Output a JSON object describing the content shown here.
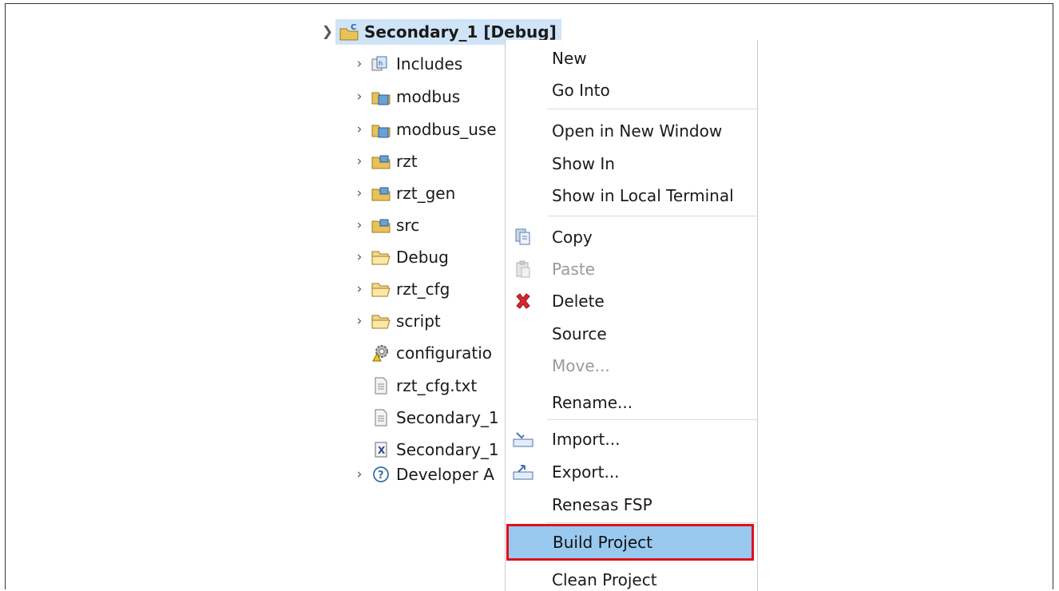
{
  "tree": {
    "root": {
      "label": "Secondary_1 [Debug]",
      "icon": "c-project-icon"
    },
    "items": [
      {
        "label": "Includes",
        "icon": "includes-icon",
        "expandable": true
      },
      {
        "label": "modbus",
        "icon": "source-folder-icon",
        "expandable": true
      },
      {
        "label": "modbus_use",
        "icon": "source-folder-icon",
        "expandable": true
      },
      {
        "label": "rzt",
        "icon": "source-folder-icon",
        "expandable": true
      },
      {
        "label": "rzt_gen",
        "icon": "source-folder-icon",
        "expandable": true
      },
      {
        "label": "src",
        "icon": "source-folder-icon",
        "expandable": true
      },
      {
        "label": "Debug",
        "icon": "folder-icon",
        "expandable": true
      },
      {
        "label": "rzt_cfg",
        "icon": "folder-icon",
        "expandable": true
      },
      {
        "label": "script",
        "icon": "folder-icon",
        "expandable": true
      },
      {
        "label": "configuratio",
        "icon": "config-gear-icon",
        "expandable": false
      },
      {
        "label": "rzt_cfg.txt",
        "icon": "text-file-icon",
        "expandable": false
      },
      {
        "label": "Secondary_1",
        "icon": "text-file-icon",
        "expandable": false
      },
      {
        "label": "Secondary_1",
        "icon": "xml-file-icon",
        "expandable": false
      },
      {
        "label": "Developer A",
        "icon": "help-icon",
        "expandable": true
      }
    ]
  },
  "context_menu": {
    "items": [
      {
        "label": "New"
      },
      {
        "label": "Go Into"
      },
      {
        "label": "Open in New Window"
      },
      {
        "label": "Show In"
      },
      {
        "label": "Show in Local Terminal"
      },
      {
        "label": "Copy",
        "icon": "copy-icon"
      },
      {
        "label": "Paste",
        "icon": "paste-icon",
        "disabled": true
      },
      {
        "label": "Delete",
        "icon": "delete-icon"
      },
      {
        "label": "Source"
      },
      {
        "label": "Move...",
        "disabled": true
      },
      {
        "label": "Rename..."
      },
      {
        "label": "Import...",
        "icon": "import-icon"
      },
      {
        "label": "Export...",
        "icon": "export-icon"
      },
      {
        "label": "Renesas FSP"
      },
      {
        "label": "Build Project",
        "highlighted": true
      },
      {
        "label": "Clean Project"
      }
    ]
  },
  "colors": {
    "selection": "#cfe4f7",
    "highlight_fill": "#99c9ef",
    "highlight_border": "#e0101a",
    "delete_red": "#d7262c"
  }
}
